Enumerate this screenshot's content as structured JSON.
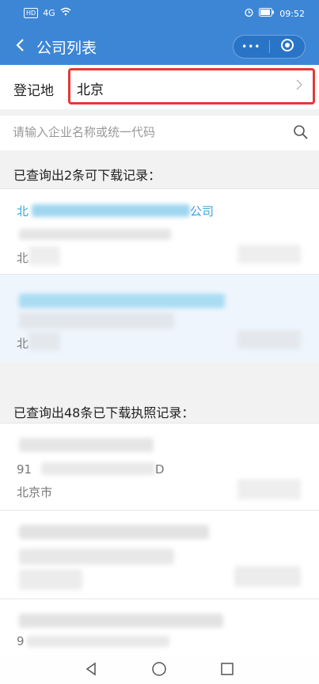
{
  "status_bar": {
    "hd_badge": "HD",
    "signal": "4G",
    "time": "09:52"
  },
  "nav": {
    "title": "公司列表",
    "menu_glyph": "•••",
    "icons": [
      "back-icon",
      "more-icon",
      "target-icon"
    ]
  },
  "region": {
    "label": "登记地",
    "value": "北京"
  },
  "search": {
    "placeholder": "请输入企业名称或统一代码"
  },
  "section1": {
    "title": "已查询出2条可下载记录："
  },
  "results_downloadable": [
    {
      "name_prefix": "北",
      "name_suffix": "公司",
      "line3_prefix": "北"
    },
    {
      "line3_prefix": "北"
    }
  ],
  "section2": {
    "title": "已查询出48条已下载执照记录："
  },
  "results_downloaded": [
    {
      "code_prefix": "91",
      "code_suffix": "D",
      "city": "北京市"
    },
    {},
    {
      "code_prefix": "9"
    }
  ],
  "colors": {
    "primary": "#3d86d6",
    "highlight_border": "#e53935",
    "name_link": "#3ca7d8"
  }
}
